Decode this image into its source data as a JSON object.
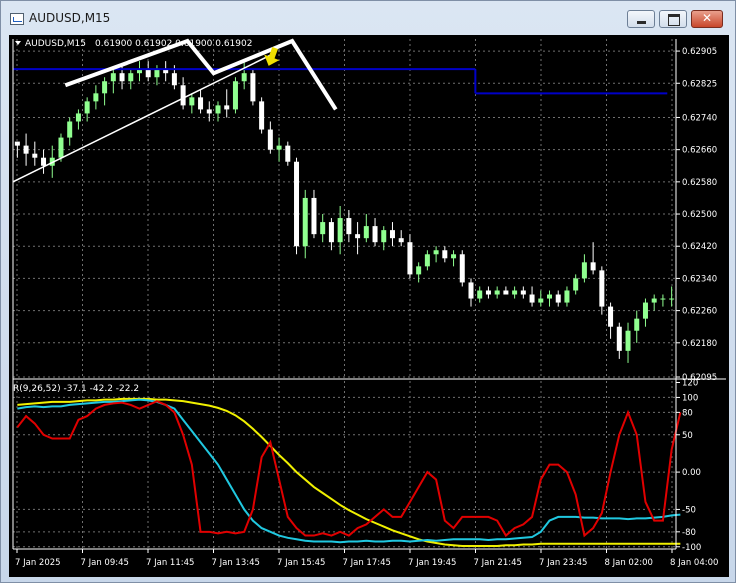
{
  "window": {
    "title": "AUDUSD,M15",
    "close_glyph": "✕"
  },
  "header": {
    "symbol_label": "AUDUSD,M15",
    "ohlc": "0.61900 0.61902 0.61900 0.61902"
  },
  "indicator_label": "R(9,26,52) -37.1 -42.2 -22.2",
  "colors": {
    "bull": "#90ff90",
    "bear": "#ffffff",
    "level_line": "#0000c8",
    "fast_line": "#e00000",
    "mid_line": "#20c8e0",
    "slow_line": "#f0f000",
    "grid": "#707070",
    "arrow": "#f0e000"
  },
  "chart_data": [
    {
      "type": "candlestick",
      "symbol": "AUDUSD",
      "timeframe": "M15",
      "ylim": [
        0.62095,
        0.62935
      ],
      "price_ticks": [
        "0.62905",
        "0.62825",
        "0.62740",
        "0.62660",
        "0.62580",
        "0.62500",
        "0.62420",
        "0.62340",
        "0.62260",
        "0.62180",
        "0.62095"
      ],
      "time_ticks": [
        "7 Jan 2025",
        "7 Jan 09:45",
        "7 Jan 11:45",
        "7 Jan 13:45",
        "7 Jan 15:45",
        "7 Jan 17:45",
        "7 Jan 19:45",
        "7 Jan 21:45",
        "7 Jan 23:45",
        "8 Jan 02:00",
        "8 Jan 04:00"
      ],
      "candles": [
        [
          0.6268,
          0.6268,
          0.6264,
          0.6267
        ],
        [
          0.6267,
          0.627,
          0.6262,
          0.6265
        ],
        [
          0.6265,
          0.6268,
          0.6262,
          0.6264
        ],
        [
          0.6264,
          0.6266,
          0.626,
          0.6262
        ],
        [
          0.6262,
          0.6267,
          0.6259,
          0.6264
        ],
        [
          0.6264,
          0.627,
          0.6263,
          0.6269
        ],
        [
          0.6269,
          0.6274,
          0.6267,
          0.6273
        ],
        [
          0.6273,
          0.6276,
          0.6271,
          0.6275
        ],
        [
          0.6275,
          0.6279,
          0.6273,
          0.6278
        ],
        [
          0.6278,
          0.6282,
          0.6276,
          0.628
        ],
        [
          0.628,
          0.6284,
          0.6277,
          0.6283
        ],
        [
          0.6283,
          0.6286,
          0.628,
          0.6285
        ],
        [
          0.6285,
          0.6287,
          0.6281,
          0.6283
        ],
        [
          0.6283,
          0.6286,
          0.6281,
          0.6285
        ],
        [
          0.6285,
          0.6288,
          0.6283,
          0.6286
        ],
        [
          0.6286,
          0.6288,
          0.6283,
          0.6284
        ],
        [
          0.6284,
          0.6287,
          0.6282,
          0.6286
        ],
        [
          0.6286,
          0.6288,
          0.6283,
          0.6285
        ],
        [
          0.6285,
          0.6287,
          0.6281,
          0.6282
        ],
        [
          0.6282,
          0.6284,
          0.6276,
          0.6277
        ],
        [
          0.6277,
          0.628,
          0.6275,
          0.6279
        ],
        [
          0.6279,
          0.6281,
          0.6275,
          0.6276
        ],
        [
          0.6276,
          0.6278,
          0.6273,
          0.6275
        ],
        [
          0.6275,
          0.6278,
          0.6273,
          0.6277
        ],
        [
          0.6277,
          0.6281,
          0.6274,
          0.6276
        ],
        [
          0.6276,
          0.6284,
          0.6275,
          0.6283
        ],
        [
          0.6283,
          0.6288,
          0.6281,
          0.6285
        ],
        [
          0.6285,
          0.6286,
          0.6277,
          0.6278
        ],
        [
          0.6278,
          0.6279,
          0.627,
          0.6271
        ],
        [
          0.6271,
          0.6273,
          0.6265,
          0.6266
        ],
        [
          0.6266,
          0.6269,
          0.6263,
          0.6267
        ],
        [
          0.6267,
          0.6268,
          0.6262,
          0.6263
        ],
        [
          0.6263,
          0.6264,
          0.624,
          0.6242
        ],
        [
          0.6242,
          0.6256,
          0.6239,
          0.6254
        ],
        [
          0.6254,
          0.6256,
          0.6244,
          0.6245
        ],
        [
          0.6245,
          0.625,
          0.6243,
          0.6248
        ],
        [
          0.6248,
          0.6249,
          0.6241,
          0.6243
        ],
        [
          0.6243,
          0.6252,
          0.624,
          0.6249
        ],
        [
          0.6249,
          0.6251,
          0.6243,
          0.6245
        ],
        [
          0.6245,
          0.6248,
          0.624,
          0.6244
        ],
        [
          0.6244,
          0.625,
          0.6243,
          0.6247
        ],
        [
          0.6247,
          0.6249,
          0.6242,
          0.6243
        ],
        [
          0.6243,
          0.6247,
          0.6241,
          0.6246
        ],
        [
          0.6246,
          0.6248,
          0.6242,
          0.6244
        ],
        [
          0.6244,
          0.6246,
          0.6242,
          0.6243
        ],
        [
          0.6243,
          0.6245,
          0.6234,
          0.6235
        ],
        [
          0.6235,
          0.6238,
          0.6233,
          0.6237
        ],
        [
          0.6237,
          0.6241,
          0.6236,
          0.624
        ],
        [
          0.624,
          0.6242,
          0.6238,
          0.6241
        ],
        [
          0.6241,
          0.6242,
          0.6238,
          0.6239
        ],
        [
          0.6239,
          0.6241,
          0.6237,
          0.624
        ],
        [
          0.624,
          0.6241,
          0.6232,
          0.6233
        ],
        [
          0.6233,
          0.6234,
          0.6227,
          0.6229
        ],
        [
          0.6229,
          0.6232,
          0.6228,
          0.6231
        ],
        [
          0.6231,
          0.6232,
          0.6229,
          0.623
        ],
        [
          0.623,
          0.6232,
          0.6229,
          0.6231
        ],
        [
          0.6231,
          0.6232,
          0.623,
          0.623
        ],
        [
          0.623,
          0.6232,
          0.6229,
          0.6231
        ],
        [
          0.6231,
          0.6232,
          0.6229,
          0.623
        ],
        [
          0.623,
          0.6232,
          0.6227,
          0.6228
        ],
        [
          0.6228,
          0.6231,
          0.6227,
          0.6229
        ],
        [
          0.6229,
          0.6231,
          0.6227,
          0.623
        ],
        [
          0.623,
          0.6231,
          0.6227,
          0.6228
        ],
        [
          0.6228,
          0.6232,
          0.6227,
          0.6231
        ],
        [
          0.6231,
          0.6235,
          0.623,
          0.6234
        ],
        [
          0.6234,
          0.624,
          0.6233,
          0.6238
        ],
        [
          0.6238,
          0.6243,
          0.6235,
          0.6236
        ],
        [
          0.6236,
          0.6237,
          0.6225,
          0.6227
        ],
        [
          0.6227,
          0.6228,
          0.6219,
          0.6222
        ],
        [
          0.6222,
          0.6223,
          0.6214,
          0.6216
        ],
        [
          0.6216,
          0.6223,
          0.6213,
          0.6221
        ],
        [
          0.6221,
          0.6226,
          0.6218,
          0.6224
        ],
        [
          0.6224,
          0.6229,
          0.6222,
          0.6228
        ],
        [
          0.6228,
          0.623,
          0.6226,
          0.6229
        ],
        [
          0.6229,
          0.623,
          0.6227,
          0.6229
        ],
        [
          0.6229,
          0.6232,
          0.6227,
          0.6229
        ]
      ],
      "level_line": [
        {
          "from": 0,
          "to": 53,
          "price": 0.6286
        },
        {
          "from": 53,
          "to": 75,
          "price": 0.628
        }
      ],
      "drawn_lines": [
        {
          "name": "trendline-thin",
          "points": [
            [
              0,
              0.6258
            ],
            [
              30,
              0.629
            ]
          ]
        },
        {
          "name": "zigzag-bold",
          "points": [
            [
              6,
              0.6282
            ],
            [
              20,
              0.6293
            ],
            [
              23,
              0.6285
            ],
            [
              32,
              0.6293
            ],
            [
              37,
              0.6276
            ]
          ]
        }
      ],
      "arrow_marker": {
        "index": 29,
        "price": 0.6288
      }
    },
    {
      "type": "line",
      "name": "indicator",
      "ylim": [
        -103,
        122
      ],
      "y_ticks": [
        "120",
        "100",
        "80",
        "50",
        "0.00",
        "-50",
        "-80",
        "-100"
      ],
      "series": [
        {
          "values": [
            60,
            75,
            65,
            50,
            45,
            45,
            45,
            70,
            75,
            85,
            90,
            92,
            93,
            90,
            85,
            90,
            95,
            90,
            80,
            50,
            10,
            -80,
            -80,
            -82,
            -80,
            -82,
            -80,
            -50,
            20,
            40,
            -10,
            -60,
            -75,
            -85,
            -85,
            -82,
            -85,
            -80,
            -85,
            -75,
            -70,
            -60,
            -50,
            -60,
            -60,
            -40,
            -20,
            0,
            -10,
            -65,
            -75,
            -60,
            -60,
            -60,
            -60,
            -65,
            -85,
            -75,
            -70,
            -60,
            -10,
            10,
            10,
            0,
            -30,
            -85,
            -75,
            -55,
            0,
            50,
            80,
            50,
            -40,
            -65,
            -65,
            30,
            80
          ]
        },
        {
          "values": [
            85,
            87,
            88,
            87,
            88,
            88,
            90,
            91,
            92,
            93,
            94,
            94,
            95,
            96,
            97,
            96,
            94,
            90,
            85,
            70,
            55,
            40,
            25,
            10,
            -10,
            -30,
            -50,
            -65,
            -75,
            -80,
            -85,
            -88,
            -90,
            -92,
            -93,
            -93,
            -93,
            -94,
            -93,
            -93,
            -92,
            -93,
            -93,
            -92,
            -92,
            -93,
            -92,
            -91,
            -92,
            -91,
            -90,
            -90,
            -90,
            -90,
            -91,
            -90,
            -90,
            -89,
            -88,
            -87,
            -80,
            -65,
            -60,
            -60,
            -60,
            -61,
            -61,
            -62,
            -62,
            -62,
            -63,
            -62,
            -62,
            -61,
            -60,
            -58,
            -57
          ]
        },
        {
          "values": [
            90,
            91,
            92,
            93,
            94,
            94,
            94,
            95,
            96,
            96,
            97,
            97,
            98,
            98,
            98,
            98,
            97,
            97,
            96,
            95,
            93,
            91,
            89,
            86,
            82,
            76,
            68,
            58,
            47,
            35,
            23,
            12,
            0,
            -10,
            -20,
            -28,
            -36,
            -44,
            -51,
            -57,
            -63,
            -68,
            -73,
            -78,
            -82,
            -86,
            -90,
            -93,
            -95,
            -97,
            -98,
            -99,
            -99,
            -99,
            -99,
            -99,
            -98,
            -98,
            -97,
            -97,
            -96,
            -96,
            -96,
            -96,
            -96,
            -96,
            -96,
            -96,
            -96,
            -96,
            -96,
            -96,
            -96,
            -96,
            -96,
            -96,
            -96
          ]
        }
      ]
    }
  ]
}
